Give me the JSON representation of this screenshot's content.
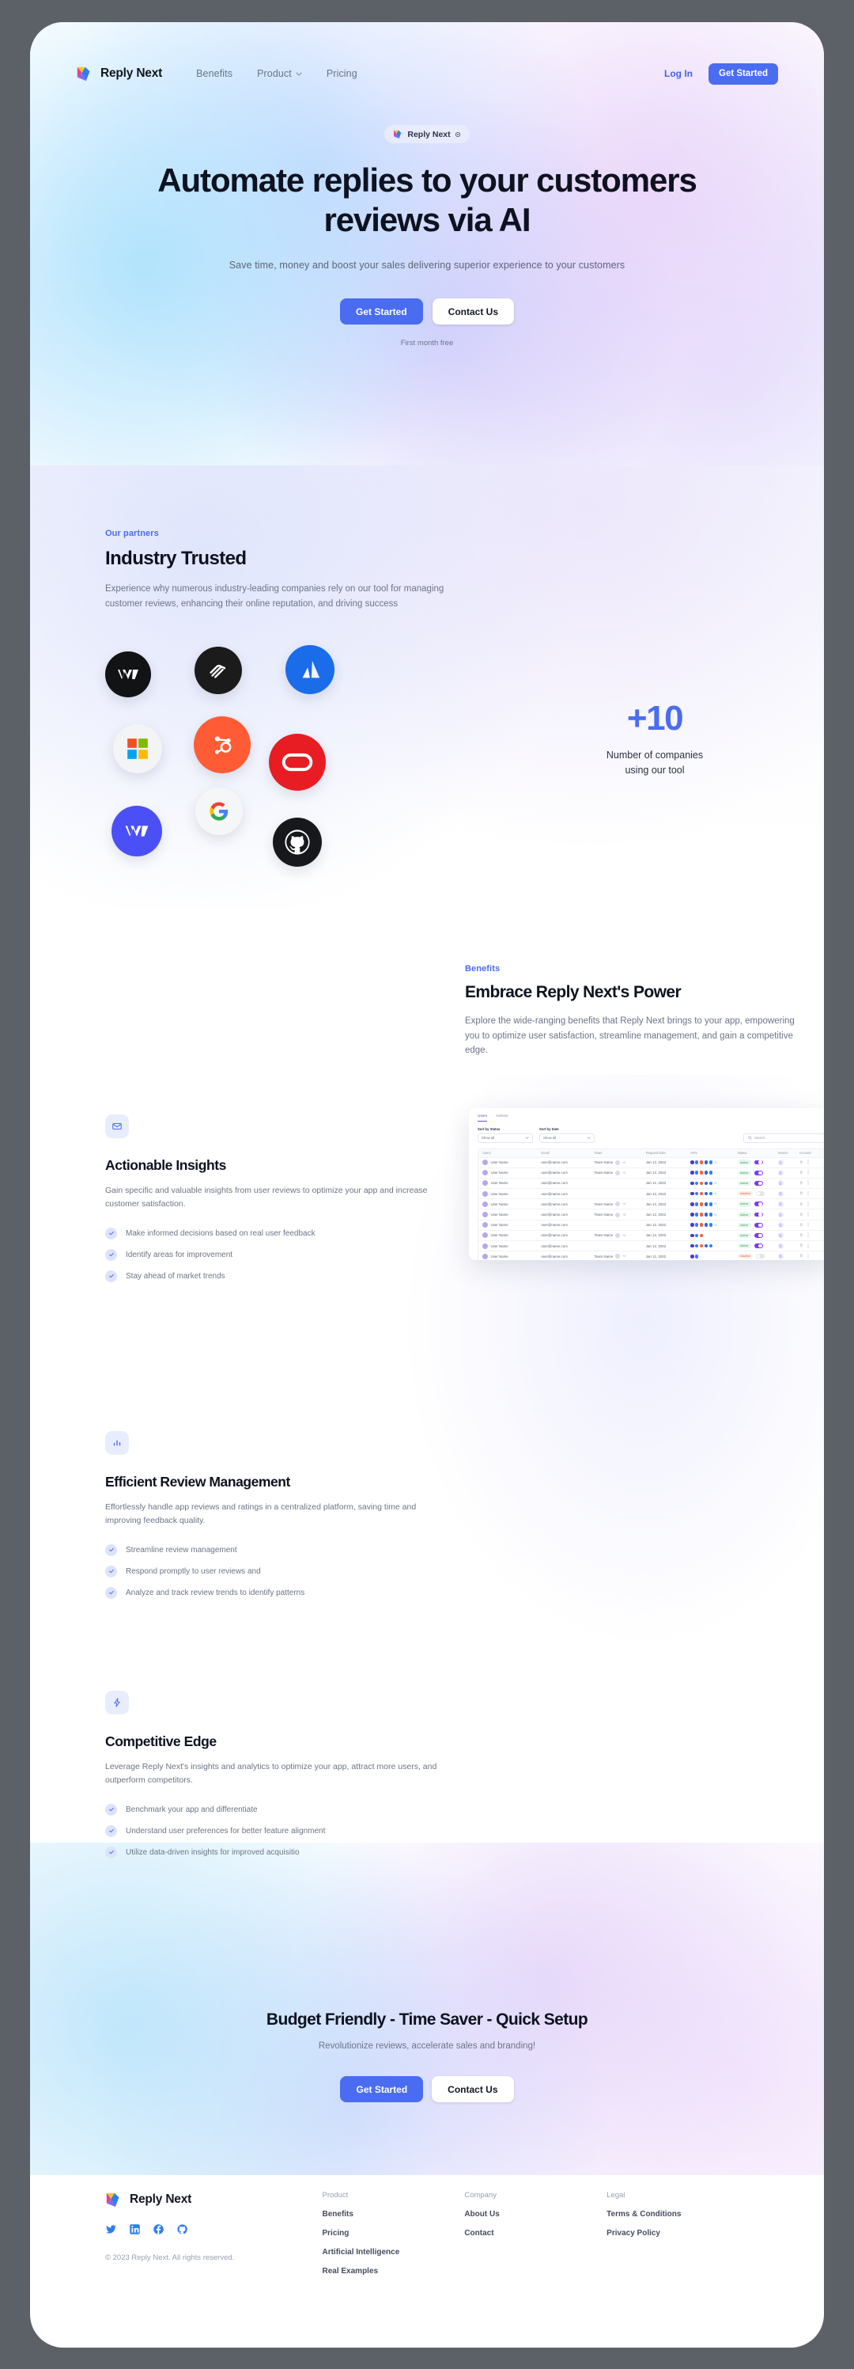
{
  "brand": {
    "name": "Reply Next",
    "logo_icon": "reply-next-logo-icon"
  },
  "nav": {
    "links": [
      {
        "label": "Benefits",
        "icon": ""
      },
      {
        "label": "Product",
        "icon": "chevron-down-icon"
      },
      {
        "label": "Pricing",
        "icon": ""
      }
    ],
    "login_label": "Log In",
    "get_started_label": "Get Started"
  },
  "hero": {
    "badge_label": "Reply Next",
    "badge_icon": "sparkle-icon",
    "title": "Automate replies to your customers reviews via AI",
    "subtitle": "Save time, money and boost your sales delivering superior experience to your customers",
    "primary_cta": "Get Started",
    "secondary_cta": "Contact Us",
    "note": "First month free"
  },
  "partners": {
    "eyebrow": "Our partners",
    "title": "Industry Trusted",
    "paragraph": "Experience why numerous industry-leading companies rely on our tool for managing customer reviews, enhancing their online reputation, and driving success",
    "logos": [
      {
        "name": "webflow-black-logo-icon"
      },
      {
        "name": "squarespace-logo-icon"
      },
      {
        "name": "atlassian-logo-icon"
      },
      {
        "name": "microsoft-logo-icon"
      },
      {
        "name": "hubspot-logo-icon"
      },
      {
        "name": "oracle-logo-icon"
      },
      {
        "name": "webflow-blue-logo-icon"
      },
      {
        "name": "google-logo-icon"
      },
      {
        "name": "github-logo-icon"
      }
    ],
    "stat_number": "+10",
    "stat_label_line1": "Number of companies",
    "stat_label_line2": "using our tool"
  },
  "benefits": {
    "eyebrow": "Benefits",
    "title": "Embrace Reply Next's Power",
    "paragraph": "Explore the wide-ranging benefits that Reply Next brings to your app, empowering you to optimize user satisfaction, streamline management, and gain a competitive edge."
  },
  "features": [
    {
      "icon": "envelope-icon",
      "title": "Actionable Insights",
      "paragraph": "Gain specific and valuable insights from user reviews to optimize your app and increase customer satisfaction.",
      "items": [
        "Make informed decisions based on real user feedback",
        "Identify areas for improvement",
        "Stay ahead of market trends"
      ]
    },
    {
      "icon": "bar-chart-icon",
      "title": "Efficient Review Management",
      "paragraph": "Effortlessly handle app reviews and ratings in a centralized platform, saving time and improving feedback quality.",
      "items": [
        "Streamline review management",
        "Respond promptly to user reviews and",
        "Analyze and track review trends to identify patterns"
      ]
    },
    {
      "icon": "lightning-bolt-icon",
      "title": "Competitive Edge",
      "paragraph": "Leverage Reply Next's insights and analytics to optimize your app, attract more users, and outperform competitors.",
      "items": [
        "Benchmark your app and differentiate",
        "Understand user preferences for better feature alignment",
        "Utilize data-driven insights for improved acquisitio"
      ]
    }
  ],
  "dashboard": {
    "tabs": [
      {
        "label": "Users",
        "active": true
      },
      {
        "label": "Admins",
        "active": false
      }
    ],
    "filters": [
      {
        "label": "Sort by Status",
        "value": "Show all"
      },
      {
        "label": "Sort by Date",
        "value": "Show all"
      }
    ],
    "search_placeholder": "Search",
    "columns": [
      "Users",
      "Email",
      "Team",
      "Request Date",
      "APIs",
      "Status",
      "Invoice",
      "Account"
    ],
    "rows": [
      {
        "user": "User Name",
        "email": "user@name.com",
        "team": "Team Name",
        "team_extra": "+2",
        "date": "Jan 12, 2022",
        "apis": 5,
        "api_extra": "+2",
        "status": "Active",
        "toggle": true
      },
      {
        "user": "User Name",
        "email": "user@name.com",
        "team": "Team Name",
        "team_extra": "+2",
        "date": "Jan 12, 2022",
        "apis": 5,
        "api_extra": "",
        "status": "Active",
        "toggle": true
      },
      {
        "user": "User Name",
        "email": "user@name.com",
        "team": "",
        "team_extra": "",
        "date": "Jan 12, 2022",
        "apis": 5,
        "api_extra": "+4",
        "status": "Active",
        "toggle": true
      },
      {
        "user": "User Name",
        "email": "user@name.com",
        "team": "",
        "team_extra": "",
        "date": "Jan 12, 2022",
        "apis": 5,
        "api_extra": "+2",
        "status": "Inactive",
        "toggle": false
      },
      {
        "user": "User Name",
        "email": "user@name.com",
        "team": "Team Name",
        "team_extra": "+4",
        "date": "Jan 12, 2022",
        "apis": 5,
        "api_extra": "+5",
        "status": "Active",
        "toggle": true
      },
      {
        "user": "User Name",
        "email": "user@name.com",
        "team": "Team Name",
        "team_extra": "+5",
        "date": "Jan 12, 2022",
        "apis": 5,
        "api_extra": "+1",
        "status": "Active",
        "toggle": true
      },
      {
        "user": "User Name",
        "email": "user@name.com",
        "team": "",
        "team_extra": "",
        "date": "Jan 12, 2022",
        "apis": 5,
        "api_extra": "+4",
        "status": "Active",
        "toggle": true
      },
      {
        "user": "User Name",
        "email": "user@name.com",
        "team": "Team Name",
        "team_extra": "+3",
        "date": "Jan 12, 2022",
        "apis": 3,
        "api_extra": "",
        "status": "Active",
        "toggle": true
      },
      {
        "user": "User Name",
        "email": "user@name.com",
        "team": "",
        "team_extra": "",
        "date": "Jan 12, 2022",
        "apis": 5,
        "api_extra": "",
        "status": "Active",
        "toggle": true
      },
      {
        "user": "User Name",
        "email": "user@name.com",
        "team": "Team Name",
        "team_extra": "+4",
        "date": "Jan 12, 2022",
        "apis": 2,
        "api_extra": "",
        "status": "Inactive",
        "toggle": false
      }
    ]
  },
  "cta": {
    "title": "Budget Friendly - Time Saver - Quick Setup",
    "subtitle": "Revolutionize reviews, accelerate sales and branding!",
    "primary_cta": "Get Started",
    "secondary_cta": "Contact Us"
  },
  "footer": {
    "copyright": "© 2023 Reply Next. All rights reserved.",
    "socials": [
      {
        "name": "twitter-icon"
      },
      {
        "name": "linkedin-icon"
      },
      {
        "name": "facebook-icon"
      },
      {
        "name": "github-icon"
      }
    ],
    "columns": [
      {
        "heading": "Product",
        "links": [
          "Benefits",
          "Pricing",
          "Artificial Intelligence",
          "Real Examples"
        ]
      },
      {
        "heading": "Company",
        "links": [
          "About Us",
          "Contact"
        ]
      },
      {
        "heading": "Legal",
        "links": [
          "Terms & Conditions",
          "Privacy Policy"
        ]
      }
    ]
  },
  "colors": {
    "accent": "#4a6cf0",
    "accent_text": "#4361ee",
    "heading": "#0e1220",
    "body": "#6d7487",
    "frame": "#5b6167"
  }
}
